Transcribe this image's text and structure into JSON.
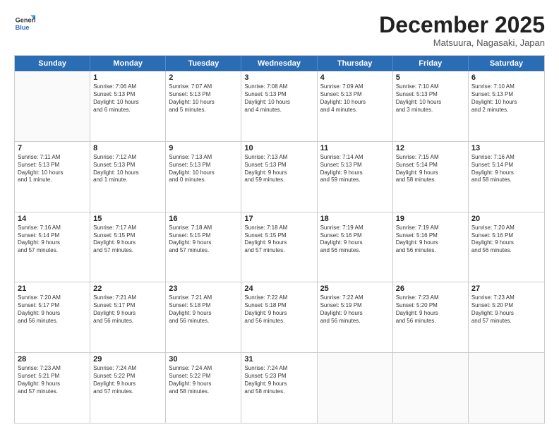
{
  "logo": {
    "general": "General",
    "blue": "Blue"
  },
  "title": "December 2025",
  "subtitle": "Matsuura, Nagasaki, Japan",
  "days": [
    "Sunday",
    "Monday",
    "Tuesday",
    "Wednesday",
    "Thursday",
    "Friday",
    "Saturday"
  ],
  "weeks": [
    [
      {
        "day": "",
        "info": ""
      },
      {
        "day": "1",
        "info": "Sunrise: 7:06 AM\nSunset: 5:13 PM\nDaylight: 10 hours\nand 6 minutes."
      },
      {
        "day": "2",
        "info": "Sunrise: 7:07 AM\nSunset: 5:13 PM\nDaylight: 10 hours\nand 5 minutes."
      },
      {
        "day": "3",
        "info": "Sunrise: 7:08 AM\nSunset: 5:13 PM\nDaylight: 10 hours\nand 4 minutes."
      },
      {
        "day": "4",
        "info": "Sunrise: 7:09 AM\nSunset: 5:13 PM\nDaylight: 10 hours\nand 4 minutes."
      },
      {
        "day": "5",
        "info": "Sunrise: 7:10 AM\nSunset: 5:13 PM\nDaylight: 10 hours\nand 3 minutes."
      },
      {
        "day": "6",
        "info": "Sunrise: 7:10 AM\nSunset: 5:13 PM\nDaylight: 10 hours\nand 2 minutes."
      }
    ],
    [
      {
        "day": "7",
        "info": "Sunrise: 7:11 AM\nSunset: 5:13 PM\nDaylight: 10 hours\nand 1 minute."
      },
      {
        "day": "8",
        "info": "Sunrise: 7:12 AM\nSunset: 5:13 PM\nDaylight: 10 hours\nand 1 minute."
      },
      {
        "day": "9",
        "info": "Sunrise: 7:13 AM\nSunset: 5:13 PM\nDaylight: 10 hours\nand 0 minutes."
      },
      {
        "day": "10",
        "info": "Sunrise: 7:13 AM\nSunset: 5:13 PM\nDaylight: 9 hours\nand 59 minutes."
      },
      {
        "day": "11",
        "info": "Sunrise: 7:14 AM\nSunset: 5:13 PM\nDaylight: 9 hours\nand 59 minutes."
      },
      {
        "day": "12",
        "info": "Sunrise: 7:15 AM\nSunset: 5:14 PM\nDaylight: 9 hours\nand 58 minutes."
      },
      {
        "day": "13",
        "info": "Sunrise: 7:16 AM\nSunset: 5:14 PM\nDaylight: 9 hours\nand 58 minutes."
      }
    ],
    [
      {
        "day": "14",
        "info": "Sunrise: 7:16 AM\nSunset: 5:14 PM\nDaylight: 9 hours\nand 57 minutes."
      },
      {
        "day": "15",
        "info": "Sunrise: 7:17 AM\nSunset: 5:15 PM\nDaylight: 9 hours\nand 57 minutes."
      },
      {
        "day": "16",
        "info": "Sunrise: 7:18 AM\nSunset: 5:15 PM\nDaylight: 9 hours\nand 57 minutes."
      },
      {
        "day": "17",
        "info": "Sunrise: 7:18 AM\nSunset: 5:15 PM\nDaylight: 9 hours\nand 57 minutes."
      },
      {
        "day": "18",
        "info": "Sunrise: 7:19 AM\nSunset: 5:16 PM\nDaylight: 9 hours\nand 56 minutes."
      },
      {
        "day": "19",
        "info": "Sunrise: 7:19 AM\nSunset: 5:16 PM\nDaylight: 9 hours\nand 56 minutes."
      },
      {
        "day": "20",
        "info": "Sunrise: 7:20 AM\nSunset: 5:16 PM\nDaylight: 9 hours\nand 56 minutes."
      }
    ],
    [
      {
        "day": "21",
        "info": "Sunrise: 7:20 AM\nSunset: 5:17 PM\nDaylight: 9 hours\nand 56 minutes."
      },
      {
        "day": "22",
        "info": "Sunrise: 7:21 AM\nSunset: 5:17 PM\nDaylight: 9 hours\nand 56 minutes."
      },
      {
        "day": "23",
        "info": "Sunrise: 7:21 AM\nSunset: 5:18 PM\nDaylight: 9 hours\nand 56 minutes."
      },
      {
        "day": "24",
        "info": "Sunrise: 7:22 AM\nSunset: 5:18 PM\nDaylight: 9 hours\nand 56 minutes."
      },
      {
        "day": "25",
        "info": "Sunrise: 7:22 AM\nSunset: 5:19 PM\nDaylight: 9 hours\nand 56 minutes."
      },
      {
        "day": "26",
        "info": "Sunrise: 7:23 AM\nSunset: 5:20 PM\nDaylight: 9 hours\nand 56 minutes."
      },
      {
        "day": "27",
        "info": "Sunrise: 7:23 AM\nSunset: 5:20 PM\nDaylight: 9 hours\nand 57 minutes."
      }
    ],
    [
      {
        "day": "28",
        "info": "Sunrise: 7:23 AM\nSunset: 5:21 PM\nDaylight: 9 hours\nand 57 minutes."
      },
      {
        "day": "29",
        "info": "Sunrise: 7:24 AM\nSunset: 5:22 PM\nDaylight: 9 hours\nand 57 minutes."
      },
      {
        "day": "30",
        "info": "Sunrise: 7:24 AM\nSunset: 5:22 PM\nDaylight: 9 hours\nand 58 minutes."
      },
      {
        "day": "31",
        "info": "Sunrise: 7:24 AM\nSunset: 5:23 PM\nDaylight: 9 hours\nand 58 minutes."
      },
      {
        "day": "",
        "info": ""
      },
      {
        "day": "",
        "info": ""
      },
      {
        "day": "",
        "info": ""
      }
    ]
  ]
}
